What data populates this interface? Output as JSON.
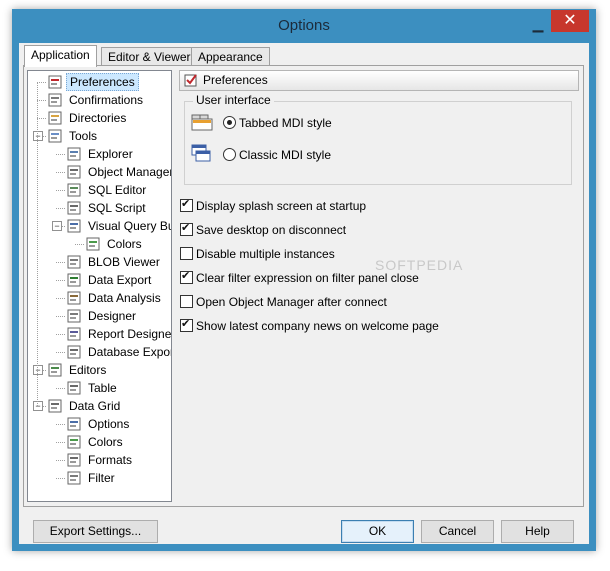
{
  "window": {
    "title": "Options"
  },
  "tabs": [
    {
      "label": "Application",
      "u": "A"
    },
    {
      "label": "Editor & Viewers",
      "u": "E"
    },
    {
      "label": "Appearance",
      "u": "p"
    }
  ],
  "tree": [
    {
      "label": "Preferences",
      "icon": "preferences-icon",
      "selected": true
    },
    {
      "label": "Confirmations",
      "icon": "confirmations-icon"
    },
    {
      "label": "Directories",
      "icon": "directories-icon"
    },
    {
      "label": "Tools",
      "icon": "tools-icon"
    },
    {
      "label": "Explorer",
      "icon": "explorer-icon"
    },
    {
      "label": "Object Manager",
      "icon": "object-manager-icon"
    },
    {
      "label": "SQL Editor",
      "icon": "sql-editor-icon"
    },
    {
      "label": "SQL Script",
      "icon": "sql-script-icon"
    },
    {
      "label": "Visual Query Builder",
      "icon": "visual-query-builder-icon"
    },
    {
      "label": "Colors",
      "icon": "colors-icon"
    },
    {
      "label": "BLOB Viewer",
      "icon": "blob-viewer-icon"
    },
    {
      "label": "Data Export",
      "icon": "data-export-icon"
    },
    {
      "label": "Data Analysis",
      "icon": "data-analysis-icon"
    },
    {
      "label": "Designer",
      "icon": "designer-icon"
    },
    {
      "label": "Report Designer",
      "icon": "report-designer-icon"
    },
    {
      "label": "Database Export",
      "icon": "database-export-icon"
    },
    {
      "label": "Editors",
      "icon": "editors-icon"
    },
    {
      "label": "Table",
      "icon": "table-icon"
    },
    {
      "label": "Data Grid",
      "icon": "data-grid-icon"
    },
    {
      "label": "Options",
      "icon": "options-icon"
    },
    {
      "label": "Colors",
      "icon": "colors-icon"
    },
    {
      "label": "Formats",
      "icon": "formats-icon"
    },
    {
      "label": "Filter",
      "icon": "filter-icon"
    }
  ],
  "content": {
    "header": "Preferences",
    "user_interface_label": "User interface",
    "radio_tabbed": "Tabbed MDI style",
    "radio_classic": "Classic MDI style",
    "selected_radio": "tabbed",
    "checks": [
      {
        "label": "Display splash screen at startup",
        "checked": true
      },
      {
        "label": "Save desktop on disconnect",
        "checked": true
      },
      {
        "label": "Disable multiple instances",
        "checked": false
      },
      {
        "label": "Clear filter expression on filter panel close",
        "checked": true
      },
      {
        "label": "Open Object Manager after connect",
        "checked": false
      },
      {
        "label": "Show latest company news on welcome page",
        "checked": true
      }
    ]
  },
  "watermark": "SOFTPEDIA",
  "buttons": {
    "export": "Export Settings...",
    "ok": "OK",
    "cancel": "Cancel",
    "help": "Help"
  }
}
